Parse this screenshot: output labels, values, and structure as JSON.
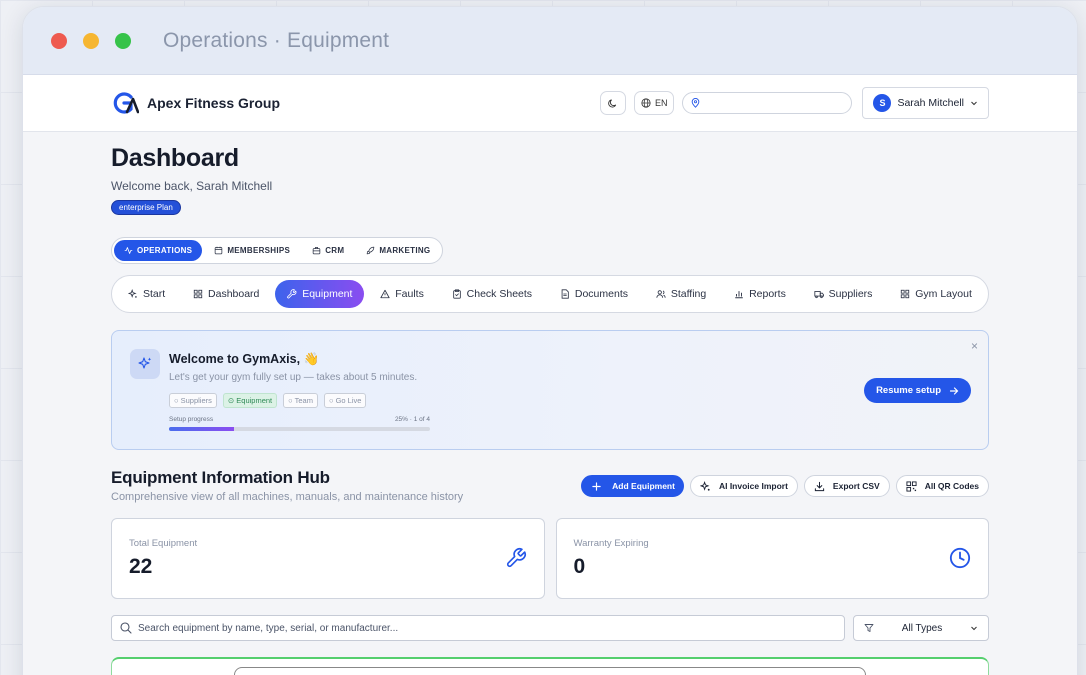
{
  "window": {
    "title": "Operations · Equipment"
  },
  "appbar": {
    "brand_name": "Apex Fitness Group",
    "lang_label": "EN",
    "location_placeholder": "",
    "user_initial": "S",
    "user_name": "Sarah Mitchell"
  },
  "header": {
    "title": "Dashboard",
    "welcome": "Welcome back, Sarah Mitchell",
    "plan_badge": "enterprise Plan"
  },
  "module_tabs": [
    {
      "label": "OPERATIONS",
      "icon": "activity-icon",
      "active": true
    },
    {
      "label": "MEMBERSHIPS",
      "icon": "calendar-icon",
      "active": false
    },
    {
      "label": "CRM",
      "icon": "briefcase-icon",
      "active": false
    },
    {
      "label": "MARKETING",
      "icon": "rocket-icon",
      "active": false
    }
  ],
  "sub_nav": [
    {
      "label": "Start",
      "icon": "sparkle-icon",
      "active": false
    },
    {
      "label": "Dashboard",
      "icon": "grid-icon",
      "active": false
    },
    {
      "label": "Equipment",
      "icon": "wrench-icon",
      "active": true
    },
    {
      "label": "Faults",
      "icon": "warning-icon",
      "active": false
    },
    {
      "label": "Check Sheets",
      "icon": "clipboard-icon",
      "active": false
    },
    {
      "label": "Documents",
      "icon": "document-icon",
      "active": false
    },
    {
      "label": "Staffing",
      "icon": "users-icon",
      "active": false
    },
    {
      "label": "Reports",
      "icon": "bar-chart-icon",
      "active": false
    },
    {
      "label": "Suppliers",
      "icon": "truck-icon",
      "active": false
    },
    {
      "label": "Gym Layout",
      "icon": "layout-icon",
      "active": false
    }
  ],
  "welcome_card": {
    "title": "Welcome to GymAxis, 👋",
    "subtitle": "Let's get your gym fully set up — takes about 5 minutes.",
    "steps": [
      {
        "label": "Suppliers",
        "done": false
      },
      {
        "label": "Equipment",
        "done": true
      },
      {
        "label": "Team",
        "done": false
      },
      {
        "label": "Go Live",
        "done": false
      }
    ],
    "progress_label": "Setup progress",
    "progress_text": "25% · 1 of 4",
    "progress_percent": 25,
    "resume_label": "Resume setup",
    "close_label": "×"
  },
  "hub": {
    "title": "Equipment Information Hub",
    "subtitle": "Comprehensive view of all machines, manuals, and maintenance history",
    "actions": {
      "add": "Add Equipment",
      "import": "AI Invoice Import",
      "export": "Export CSV",
      "qr": "All QR Codes"
    }
  },
  "stats": [
    {
      "label": "Total Equipment",
      "value": "22",
      "icon": "wrench-icon",
      "color": "#2456e8"
    },
    {
      "label": "Warranty Expiring",
      "value": "0",
      "icon": "clock-icon",
      "color": "#2456e8"
    }
  ],
  "search": {
    "placeholder": "Search equipment by name, type, serial, or manufacturer...",
    "type_filter": "All Types"
  },
  "colors": {
    "accent": "#2456e8",
    "gradient_end": "#8a4df0",
    "success": "#55cf6e"
  }
}
